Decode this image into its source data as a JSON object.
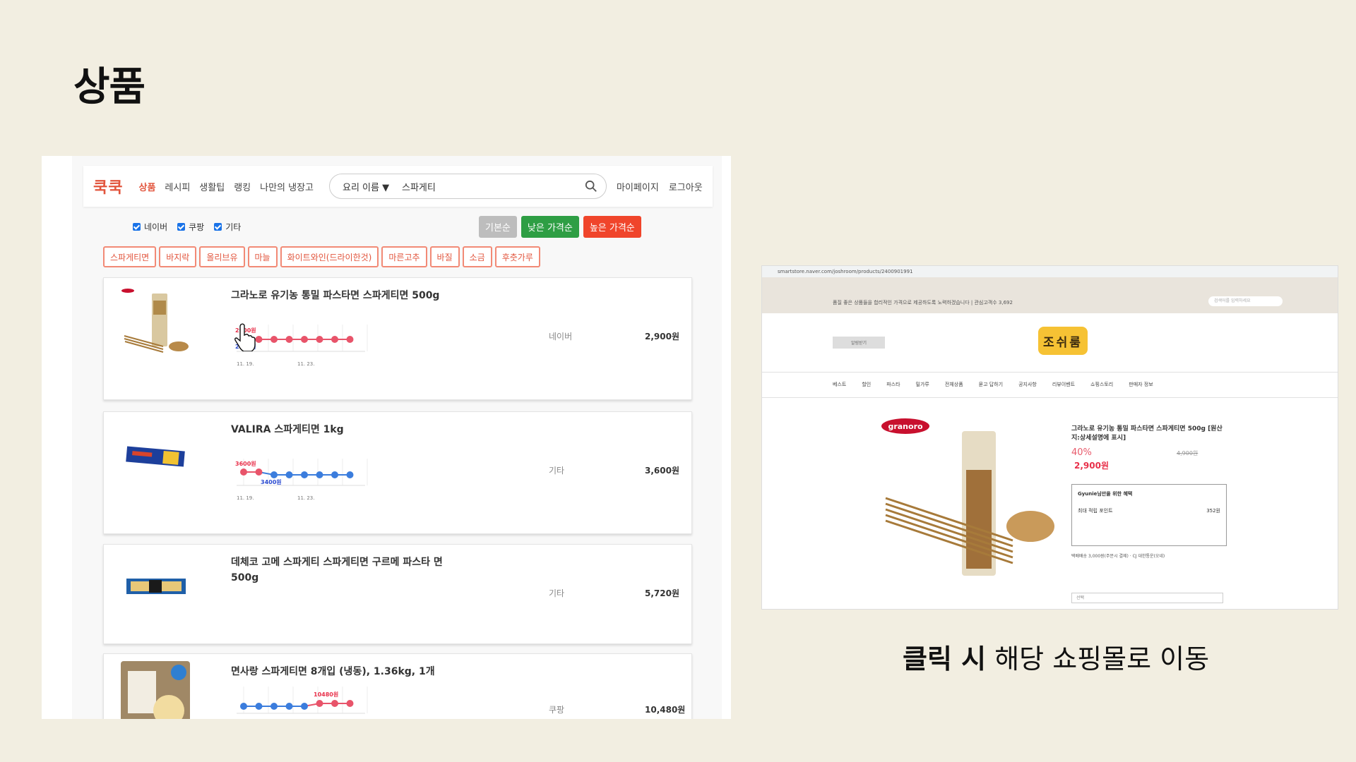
{
  "slide": {
    "title": "상품",
    "caption_bold": "클릭 시",
    "caption_rest": " 해당 쇼핑몰로 이동"
  },
  "app": {
    "logo": "쿡쿡",
    "nav": [
      "상품",
      "레시피",
      "생활팁",
      "랭킹",
      "나만의 냉장고"
    ],
    "search_type": "요리 이름 ▼",
    "search_value": "스파게티",
    "mypage": "마이페이지",
    "logout": "로그아웃",
    "filters": [
      "네이버",
      "쿠팡",
      "기타"
    ],
    "sort": [
      {
        "label": "기본순",
        "color": "#bdbdbd"
      },
      {
        "label": "낮은 가격순",
        "color": "#2e9e44"
      },
      {
        "label": "높은 가격순",
        "color": "#f0452b"
      }
    ],
    "tags": [
      "스파게티면",
      "바지락",
      "올리브유",
      "마늘",
      "화이트와인(드라이한것)",
      "마른고추",
      "바질",
      "소금",
      "후춧가루"
    ]
  },
  "products": [
    {
      "name": "그라노로 유기농 통밀 파스타면 스파게티면 500g",
      "shop": "네이버",
      "price": "2,900원",
      "label_top": "2900원",
      "label_bottom": "2900원",
      "dates": [
        "11. 19.",
        "11. 23."
      ],
      "points": [
        2900,
        2900,
        2900,
        2900,
        2900,
        2900,
        2900,
        2900
      ]
    },
    {
      "name": "VALIRA 스파게티면 1kg",
      "shop": "기타",
      "price": "3,600원",
      "label_top": "3600원",
      "label_bottom": "3400원",
      "dates": [
        "11. 19.",
        "11. 23."
      ],
      "points": [
        3600,
        3600,
        3400,
        3400,
        3400,
        3400,
        3400,
        3400
      ]
    },
    {
      "name": "데체코 고메 스파게티 스파게티면 구르메 파스타 면 500g",
      "shop": "기타",
      "price": "5,720원"
    },
    {
      "name": "면사랑 스파게티면 8개입 (냉동), 1.36kg, 1개",
      "shop": "쿠팡",
      "price": "10,480원",
      "label_top": "10480원",
      "points": [
        10000,
        10000,
        10000,
        10000,
        10000,
        10480,
        10480,
        10480
      ]
    }
  ],
  "store": {
    "url": "smartstore.naver.com/joshroom/products/2400901991",
    "banner": "품질 좋은 상품들을 합리적인 가격으로 제공하도록 노력하겠습니다  |  관심고객수 3,692",
    "search_placeholder": "검색어를 입력하세요",
    "logo": "조쉬룸",
    "follow": "알림받기",
    "menu": [
      "베스트",
      "할인",
      "파스타",
      "밀가루",
      "전체상품",
      "묻고 답하기",
      "공지사항",
      "리뷰이벤트",
      "쇼핑스토리",
      "판매자 정보"
    ],
    "product_title": "그라노로 유기농 통밀 파스타면 스파게티면 500g [원산지:상세설명에 표시]",
    "discount": "40%",
    "old_price": "4,900원",
    "new_price": "2,900원",
    "benefit_title": "Gyunie님만을 위한 혜택",
    "max_points": "최대 적립 포인트",
    "max_points_value": "352원",
    "shipping": "택배배송  3,000원(주문시 결제) · CJ 대한통운(오네)",
    "select": "선택",
    "brand": "granoro"
  }
}
